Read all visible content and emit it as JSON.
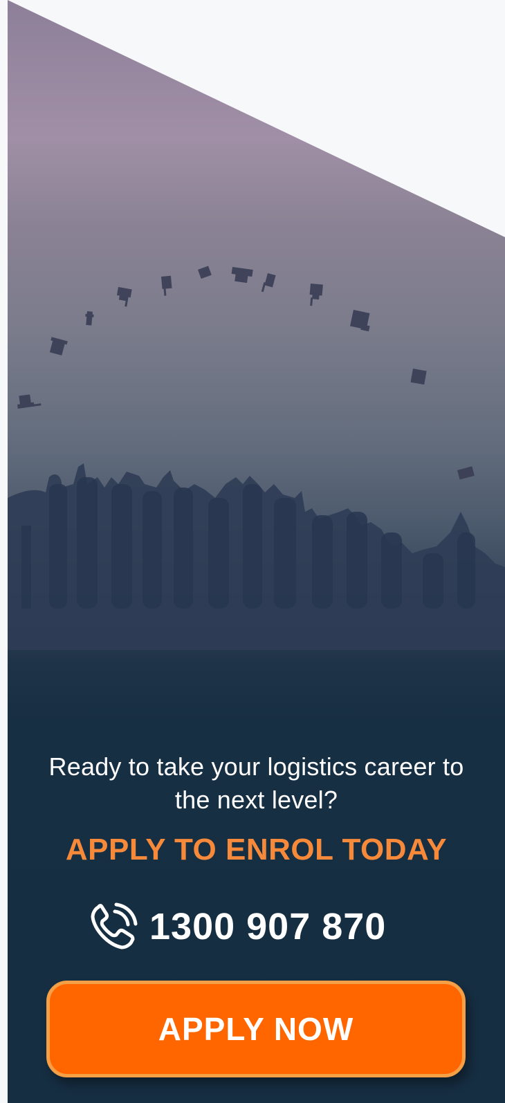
{
  "hero": {
    "image": "graduates-throwing-caps-silhouette"
  },
  "cta": {
    "tagline_line1": "Ready to take your logistics career to",
    "tagline_line2": "the next level?",
    "heading": "APPLY TO ENROL TODAY",
    "phone_icon": "phone-ringing-icon",
    "phone_number": "1300 907 870",
    "apply_button_label": "APPLY NOW"
  },
  "colors": {
    "accent_orange": "#f68a3a",
    "button_orange": "#ff6600",
    "button_border": "#f5a046",
    "navy": "#162e42",
    "white": "#ffffff"
  }
}
